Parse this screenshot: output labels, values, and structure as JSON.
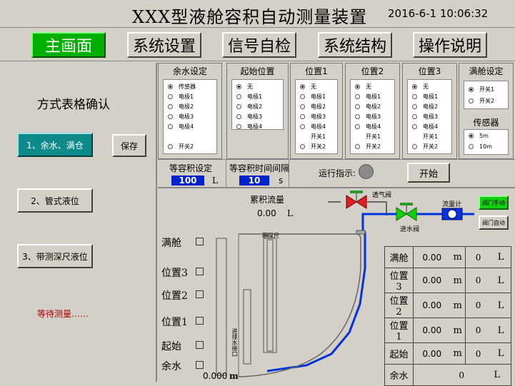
{
  "header": {
    "title": "XXX型液舱容积自动测量装置",
    "datetime": "2016-6-1 10:06:32"
  },
  "nav": [
    "主画面",
    "系统设置",
    "信号自检",
    "系统结构",
    "操作说明"
  ],
  "left": {
    "mode_title": "方式表格确认",
    "btn1": "1、余水、满仓",
    "save": "保存",
    "btn2": "2、管式液位",
    "btn3": "3、带测深尺液位",
    "status": "等待测量……"
  },
  "groups": {
    "yushui": {
      "title": "余水设定",
      "opts": [
        "传感器",
        "电极1",
        "电极2",
        "电极3",
        "电极4",
        "开关2"
      ]
    },
    "qishi": {
      "title": "起始位置",
      "opts": [
        "无",
        "电极1",
        "电极2",
        "电极3",
        "电极4"
      ]
    },
    "pos1": {
      "title": "位置1",
      "opts": [
        "无",
        "电极1",
        "电极2",
        "电极3",
        "电极4",
        "开关1",
        "开关2"
      ]
    },
    "pos2": {
      "title": "位置2",
      "opts": [
        "无",
        "电极1",
        "电极2",
        "电极3",
        "电极4",
        "开关1",
        "开关2"
      ]
    },
    "pos3": {
      "title": "位置3",
      "opts": [
        "无",
        "电极1",
        "电极2",
        "电极3",
        "电极4",
        "开关1",
        "开关2"
      ]
    },
    "mancang": {
      "title": "满舱设定",
      "opts": [
        "开关1",
        "开关2"
      ]
    },
    "sensor": {
      "title": "传感器",
      "opts": [
        "5m",
        "10m"
      ]
    }
  },
  "settings": {
    "vol_label": "等容积设定",
    "vol_value": "100",
    "vol_unit": "L",
    "interval_label": "等容积时间间隔",
    "interval_value": "10",
    "interval_unit": "s",
    "run_label": "运行指示:",
    "start": "开始"
  },
  "diagram": {
    "flow_label": "累积流量",
    "flow_value": "0.00",
    "flow_unit": "L",
    "vent_valve": "透气阀",
    "inlet_valve": "进水阀",
    "flowmeter": "流量计",
    "valve_manual": "阀门手动",
    "valve_auto": "阀门自动",
    "dipstick": "测深尺",
    "pipe_label": "进排水接口",
    "levels": [
      "满舱",
      "位置3",
      "位置2",
      "位置1",
      "起始",
      "余水"
    ],
    "depth": "0.000",
    "depth_unit": "m"
  },
  "results": [
    {
      "name": "满舱",
      "m": "0.00",
      "mu": "m",
      "v": "0",
      "vu": "L"
    },
    {
      "name": "位置3",
      "m": "0.00",
      "mu": "m",
      "v": "0",
      "vu": "L"
    },
    {
      "name": "位置2",
      "m": "0.00",
      "mu": "m",
      "v": "0",
      "vu": "L"
    },
    {
      "name": "位置1",
      "m": "0.00",
      "mu": "m",
      "v": "0",
      "vu": "L"
    },
    {
      "name": "起始",
      "m": "0.00",
      "mu": "m",
      "v": "0",
      "vu": "L"
    },
    {
      "name": "余水",
      "v": "0",
      "vu": "L"
    }
  ],
  "colors": {
    "accent": "#00b000",
    "teal": "#0f8a8a",
    "value_box": "#0022cc",
    "pipe": "#0033dd"
  }
}
